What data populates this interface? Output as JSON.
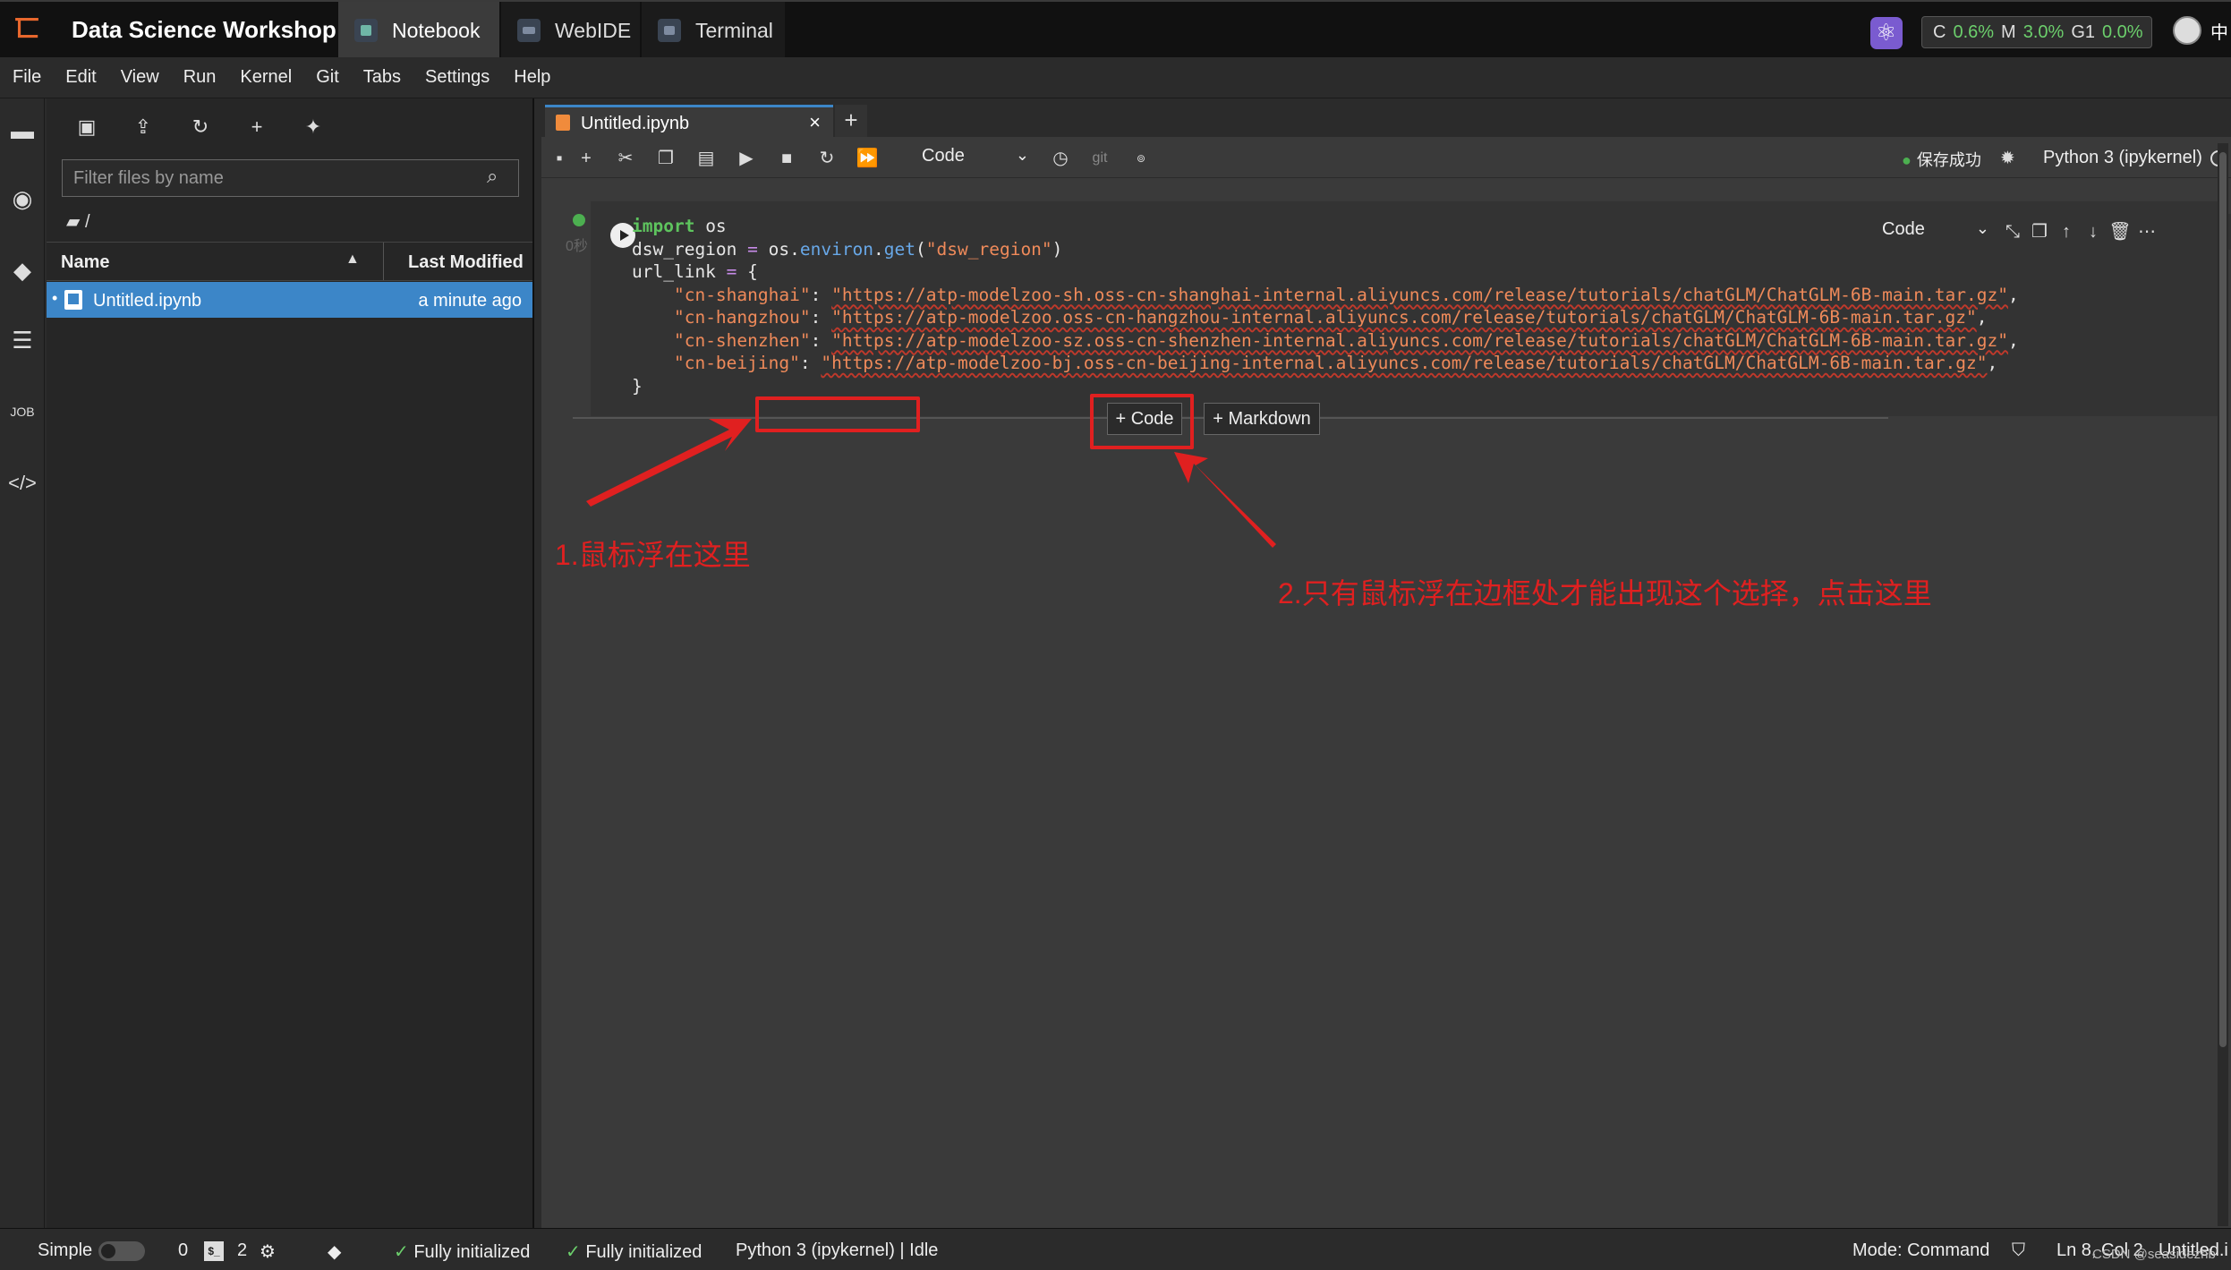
{
  "topbar": {
    "app_title": "Data Science Workshop",
    "tabs": [
      {
        "label": "Notebook",
        "active": true
      },
      {
        "label": "WebIDE",
        "active": false
      },
      {
        "label": "Terminal",
        "active": false
      }
    ],
    "resources": {
      "c_label": "C",
      "c_value": "0.6%",
      "m_label": "M",
      "m_value": "3.0%",
      "g_label": "G1",
      "g_value": "0.0%"
    },
    "lang": "中"
  },
  "menu": [
    "File",
    "Edit",
    "View",
    "Run",
    "Kernel",
    "Git",
    "Tabs",
    "Settings",
    "Help"
  ],
  "file_browser": {
    "filter_placeholder": "Filter files by name",
    "breadcrumb": "/",
    "columns": {
      "name": "Name",
      "modified": "Last Modified"
    },
    "files": [
      {
        "name": "Untitled.ipynb",
        "modified": "a minute ago",
        "selected": true
      }
    ]
  },
  "notebook": {
    "tab_label": "Untitled.ipynb",
    "cell_type": "Code",
    "git_label": "git",
    "save_status": "保存成功",
    "kernel": "Python 3 (ipykernel)",
    "cell": {
      "exec_time": "0秒",
      "lines": [
        "import os",
        "dsw_region = os.environ.get(\"dsw_region\")",
        "url_link = {",
        "    \"cn-shanghai\": \"https://atp-modelzoo-sh.oss-cn-shanghai-internal.aliyuncs.com/release/tutorials/chatGLM/ChatGLM-6B-main.tar.gz\",",
        "    \"cn-hangzhou\": \"https://atp-modelzoo.oss-cn-hangzhou-internal.aliyuncs.com/release/tutorials/chatGLM/ChatGLM-6B-main.tar.gz\",",
        "    \"cn-shenzhen\": \"https://atp-modelzoo-sz.oss-cn-shenzhen-internal.aliyuncs.com/release/tutorials/chatGLM/ChatGLM-6B-main.tar.gz\",",
        "    \"cn-beijing\": \"https://atp-modelzoo-bj.oss-cn-beijing-internal.aliyuncs.com/release/tutorials/chatGLM/ChatGLM-6B-main.tar.gz\",",
        "}"
      ]
    },
    "add_code_label": "+ Code",
    "add_markdown_label": "+ Markdown"
  },
  "annotations": {
    "step1": "1.鼠标浮在这里",
    "step2": "2.只有鼠标浮在边框处才能出现这个选择，点击这里",
    "color": "#e02020"
  },
  "statusbar": {
    "mode_label": "Simple",
    "terminals_count": "0",
    "kernels_count": "2",
    "init_1": "Fully initialized",
    "init_2": "Fully initialized",
    "kernel_status": "Python 3 (ipykernel) | Idle",
    "mode": "Mode: Command",
    "cursor": "Ln 8, Col 2",
    "file": "Untitled.i",
    "watermark": "CSDN @seasidezhb"
  },
  "colors": {
    "accent": "#3c86c8",
    "success": "#4caf50",
    "brand": "#e8672d"
  }
}
